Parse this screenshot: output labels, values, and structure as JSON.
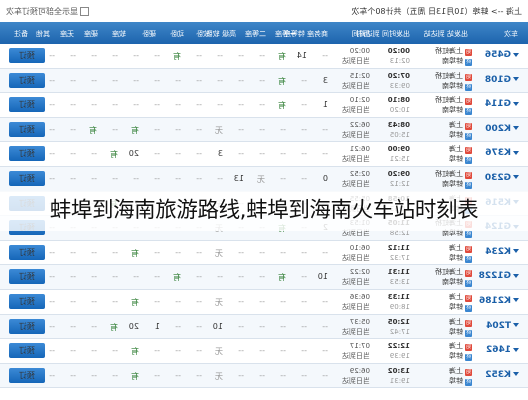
{
  "topbar": {
    "route": "上海 --> 蚌埠（10月13日 周五）共计80个车次",
    "hide_option": "显示全部可预订车次"
  },
  "header": {
    "cols": [
      "车次",
      "出发站 到达站",
      "出发时间 到达时间",
      "历时",
      "商务座 特等座",
      "一等座",
      "二等座",
      "高级 软卧",
      "软卧",
      "动卧",
      "硬卧",
      "软座",
      "硬座",
      "无座",
      "其他",
      "备注"
    ]
  },
  "rows": [
    {
      "train": "G456",
      "from": "上海虹桥",
      "to": "蚌埠南",
      "dep": "00:20",
      "arr": "02:13",
      "dur": "00:20",
      "dur2": "当日到达",
      "cells": [
        "",
        "14",
        "有",
        "",
        "",
        "",
        "",
        "有",
        "",
        "",
        "",
        "",
        "",
        "--"
      ]
    },
    {
      "train": "G108",
      "from": "上海虹桥",
      "to": "蚌埠南",
      "dep": "07:20",
      "arr": "09:33",
      "dur": "02:15",
      "dur2": "当日到达",
      "cells": [
        "3",
        "",
        "有",
        "",
        "",
        "",
        "",
        "",
        "",
        "",
        "",
        "",
        "",
        ""
      ]
    },
    {
      "train": "G114",
      "from": "上海虹桥",
      "to": "蚌埠南",
      "dep": "08:10",
      "arr": "10:20",
      "dur": "02:10",
      "dur2": "当日到达",
      "cells": [
        "1",
        "",
        "有",
        "",
        "",
        "",
        "",
        "",
        "",
        "",
        "",
        "",
        "",
        ""
      ]
    },
    {
      "train": "K200",
      "from": "上海",
      "to": "蚌埠",
      "dep": "08:43",
      "arr": "15:05",
      "dur": "06:22",
      "dur2": "当日到达",
      "cells": [
        "",
        "",
        "",
        "",
        "",
        "无",
        "",
        "",
        "",
        "有",
        "",
        "有",
        "",
        ""
      ]
    },
    {
      "train": "K376",
      "from": "上海",
      "to": "蚌埠",
      "dep": "09:00",
      "arr": "15:21",
      "dur": "06:21",
      "dur2": "当日到达",
      "cells": [
        "",
        "",
        "",
        "",
        "",
        "3",
        "",
        "",
        "",
        "20",
        "有",
        "",
        "",
        ""
      ]
    },
    {
      "train": "G230",
      "from": "上海虹桥",
      "to": "蚌埠南",
      "dep": "09:20",
      "arr": "12:12",
      "dur": "02:52",
      "dur2": "当日到达",
      "cells": [
        "0",
        "",
        "",
        "无",
        "13",
        "",
        "",
        "",
        "",
        "",
        "",
        "",
        "",
        ""
      ]
    },
    {
      "train": "K516",
      "from": "上海",
      "to": "蚌埠",
      "dep": "10:58",
      "arr": "16:53",
      "dur": "05:55",
      "dur2": "当日到达",
      "cells": [
        "",
        "",
        "",
        "",
        "",
        "无",
        "",
        "",
        "",
        "2",
        "有",
        "",
        "",
        ""
      ]
    },
    {
      "train": "G124",
      "from": "上海虹桥",
      "to": "蚌埠南",
      "dep": "11:05",
      "arr": "12:58",
      "dur": "01:53",
      "dur2": "当日到达",
      "cells": [
        "2",
        "",
        "有",
        "",
        "",
        "无",
        "",
        "",
        "",
        "",
        "",
        "",
        "",
        ""
      ]
    },
    {
      "train": "K234",
      "from": "上海",
      "to": "蚌埠",
      "dep": "11:12",
      "arr": "17:32",
      "dur": "06:10",
      "dur2": "当日到达",
      "cells": [
        "",
        "",
        "",
        "",
        "",
        "无",
        "",
        "",
        "",
        "有",
        "",
        "",
        "",
        ""
      ]
    },
    {
      "train": "G1228",
      "from": "上海虹桥",
      "to": "蚌埠南",
      "dep": "11:31",
      "arr": "13:53",
      "dur": "02:22",
      "dur2": "当日到达",
      "cells": [
        "10",
        "",
        "有",
        "",
        "",
        "",
        "",
        "有",
        "",
        "",
        "",
        "",
        "",
        ""
      ]
    },
    {
      "train": "K2186",
      "from": "上海",
      "to": "蚌埠",
      "dep": "11:33",
      "arr": "18:09",
      "dur": "06:36",
      "dur2": "当日到达",
      "cells": [
        "",
        "",
        "",
        "",
        "",
        "无",
        "",
        "",
        "",
        "有",
        "",
        "",
        "",
        ""
      ]
    },
    {
      "train": "T204",
      "from": "上海",
      "to": "蚌埠",
      "dep": "12:05",
      "arr": "17:42",
      "dur": "05:37",
      "dur2": "当日到达",
      "cells": [
        "",
        "",
        "",
        "",
        "",
        "10",
        "",
        "",
        "1",
        "20",
        "有",
        "",
        "",
        ""
      ]
    },
    {
      "train": "1462",
      "from": "上海",
      "to": "蚌埠",
      "dep": "12:22",
      "arr": "19:39",
      "dur": "07:17",
      "dur2": "当日到达",
      "cells": [
        "",
        "",
        "",
        "",
        "",
        "无",
        "",
        "",
        "",
        "有",
        "",
        "",
        "",
        ""
      ]
    },
    {
      "train": "K352",
      "from": "上海",
      "to": "蚌埠",
      "dep": "13:02",
      "arr": "19:31",
      "dur": "06:29",
      "dur2": "当日到达",
      "cells": [
        "",
        "",
        "",
        "",
        "",
        "无",
        "",
        "",
        "",
        "有",
        "",
        "",
        "",
        ""
      ]
    }
  ],
  "book_label": "预订",
  "caption": "蚌埠到海南旅游路线,蚌埠到海南火车站时刻表"
}
